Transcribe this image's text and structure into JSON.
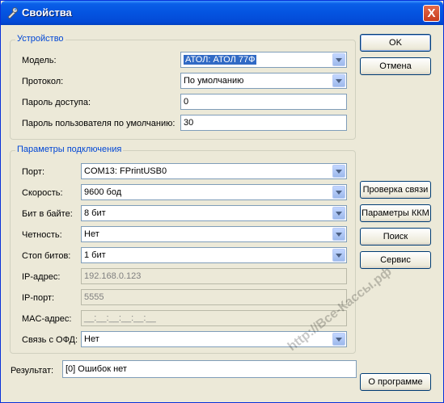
{
  "window": {
    "title": "Свойства",
    "close_glyph": "X"
  },
  "device_group": {
    "legend": "Устройство",
    "model_label": "Модель:",
    "model_value": "АТОЛ: АТОЛ 77Ф",
    "protocol_label": "Протокол:",
    "protocol_value": "По умолчанию",
    "access_password_label": "Пароль доступа:",
    "access_password_value": "0",
    "user_password_label": "Пароль пользователя по умолчанию:",
    "user_password_value": "30"
  },
  "connection_group": {
    "legend": "Параметры подключения",
    "port_label": "Порт:",
    "port_value": "COM13: FPrintUSB0",
    "speed_label": "Скорость:",
    "speed_value": "9600 бод",
    "bits_label": "Бит в байте:",
    "bits_value": "8 бит",
    "parity_label": "Четность:",
    "parity_value": "Нет",
    "stopbits_label": "Стоп битов:",
    "stopbits_value": "1 бит",
    "ip_label": "IP-адрес:",
    "ip_value": "192.168.0.123",
    "ipport_label": "IP-порт:",
    "ipport_value": "5555",
    "mac_label": "MAC-адрес:",
    "mac_value": "__:__:__:__:__:__",
    "ofd_label": "Связь с ОФД:",
    "ofd_value": "Нет"
  },
  "result": {
    "label": "Результат:",
    "value": "[0] Ошибок нет"
  },
  "buttons": {
    "ok": "OK",
    "cancel": "Отмена",
    "check_connection": "Проверка связи",
    "kkm_params": "Параметры ККМ",
    "search": "Поиск",
    "service": "Сервис",
    "about": "О программе"
  },
  "watermark": "http://Все-Кассы.рф"
}
